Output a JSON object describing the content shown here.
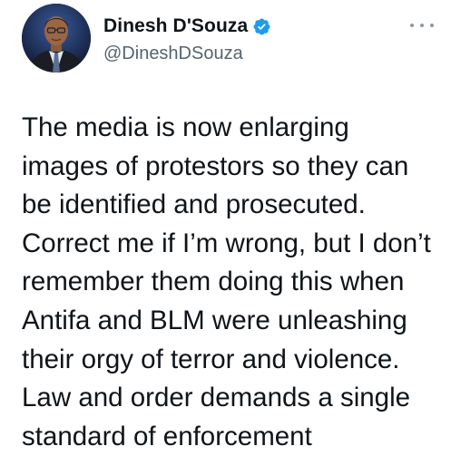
{
  "tweet": {
    "author": {
      "display_name": "Dinesh D'Souza",
      "handle": "@DineshDSouza",
      "verified": true,
      "avatar_icon": "profile-photo"
    },
    "more_icon": "ellipsis-icon",
    "text_lines": [
      "The media is now enlarging",
      "images of protestors so they can",
      "be identified and prosecuted.",
      "Correct me if I’m wrong, but I don’t",
      "remember them doing this when",
      "Antifa and BLM were unleashing",
      "their orgy of terror and violence.",
      "Law and order demands a single",
      "standard of enforcement"
    ]
  },
  "colors": {
    "text_primary": "#0f1419",
    "text_secondary": "#536471",
    "verified_badge": "#1d9bf0",
    "background": "#ffffff"
  }
}
